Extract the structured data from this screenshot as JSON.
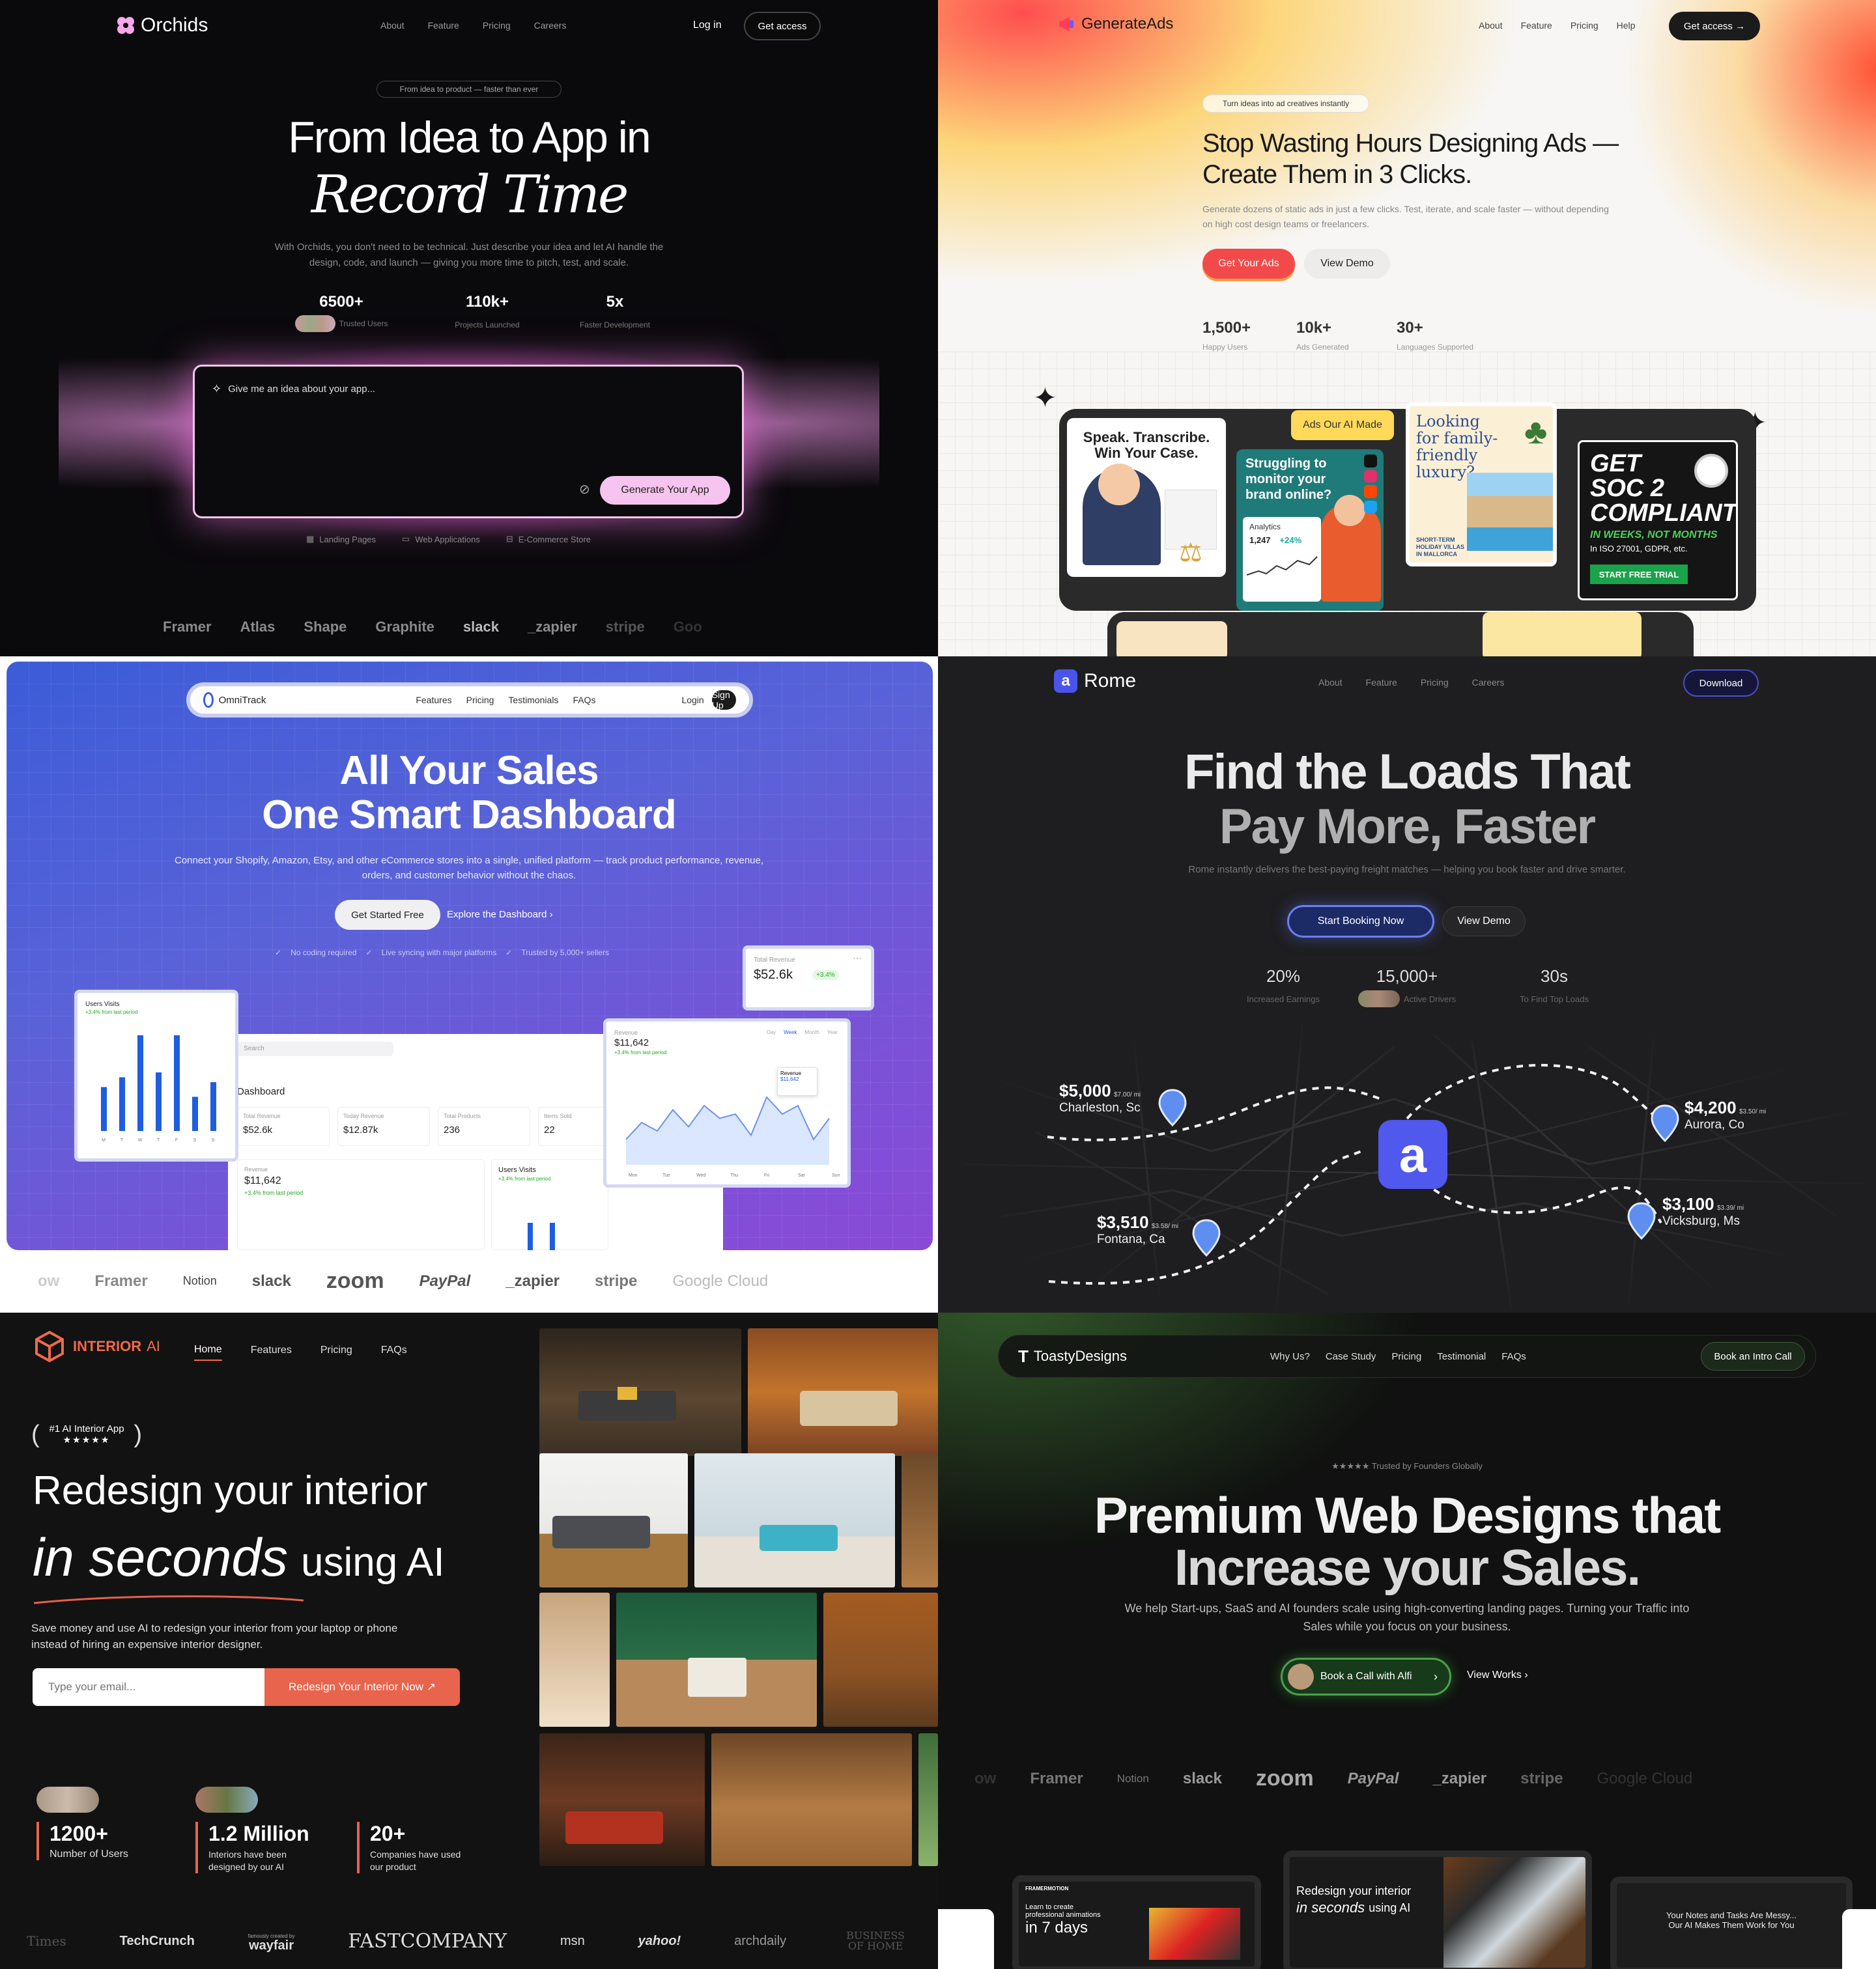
{
  "orchids": {
    "brand": "Orchids",
    "nav": [
      "About",
      "Feature",
      "Pricing",
      "Careers"
    ],
    "login": "Log in",
    "cta": "Get access",
    "badge": "From idea to product — faster than ever",
    "title1": "From Idea to App in",
    "title2": "Record Time",
    "sub": "With Orchids, you don't need to be technical. Just describe your idea and let AI handle the design, code, and launch — giving you more time to pitch, test, and scale.",
    "stats": [
      {
        "v": "6500+",
        "l": "Trusted Users"
      },
      {
        "v": "110k+",
        "l": "Projects Launched"
      },
      {
        "v": "5x",
        "l": "Faster Development"
      }
    ],
    "prompt_placeholder": "Give me an idea about your app...",
    "generate": "Generate Your App",
    "tags": [
      "Landing Pages",
      "Web Applications",
      "E-Commerce Store"
    ],
    "logos": [
      "Framer",
      "Atlas",
      "Shape",
      "Graphite",
      "slack",
      "_zapier",
      "stripe",
      "Goo"
    ]
  },
  "genads": {
    "brand": "GenerateAds",
    "nav": [
      "About",
      "Feature",
      "Pricing",
      "Help"
    ],
    "cta": "Get access →",
    "badge": "Turn ideas into ad creatives instantly",
    "title1": "Stop Wasting Hours Designing Ads —",
    "title2": "Create Them in 3 Clicks.",
    "sub": "Generate dozens of static ads in just a few clicks. Test, iterate, and scale faster — without depending on high cost design teams or freelancers.",
    "btn_primary": "Get Your Ads",
    "btn_secondary": "View Demo",
    "stats": [
      {
        "v": "1,500+",
        "l": "Happy Users"
      },
      {
        "v": "10k+",
        "l": "Ads Generated"
      },
      {
        "v": "30+",
        "l": "Languages Supported"
      }
    ],
    "made_label": "Ads Our AI Made",
    "card1": "Speak. Transcribe. Win Your Case.",
    "card2": "Struggling to monitor your brand online?",
    "card2_sub": "Analytics",
    "card2_m1": "1,247",
    "card2_m2": "+24%",
    "card3": "Looking for family-friendly luxury?",
    "card3_sub": "SHORT-TERM HOLIDAY VILLAS IN MALLORCA",
    "card4_t1": "GET",
    "card4_t2": "SOC 2",
    "card4_t3": "COMPLIANT",
    "card4_t4": "IN WEEKS, NOT MONTHS",
    "card4_t5": "In ISO 27001, GDPR, etc.",
    "card4_btn": "START FREE TRIAL"
  },
  "omni": {
    "brand": "OmniTrack",
    "nav": [
      "Features",
      "Pricing",
      "Testimonials",
      "FAQs"
    ],
    "login": "Login",
    "signup": "Sign Up",
    "title1": "All Your Sales",
    "title2": "One Smart Dashboard",
    "sub": "Connect your Shopify, Amazon, Etsy, and other eCommerce stores into a single, unified platform — track product performance, revenue, orders, and customer behavior without the chaos.",
    "btn_primary": "Get Started Free",
    "btn_secondary": "Explore the Dashboard ›",
    "checks": [
      "No coding required",
      "Live syncing with major platforms",
      "Trusted by 5,000+ sellers"
    ],
    "total_rev_label": "Total Revenue",
    "total_rev": "$52.6k",
    "total_rev_delta": "+3.4%",
    "users_visits": "Users Visits",
    "uv_delta": "+3.4% from last period",
    "rev_label": "Revenue",
    "rev_value": "$11,642",
    "rev_delta": "+3.4% from last period",
    "dash_title": "Dashboard",
    "search": "Search",
    "kpis": [
      {
        "l": "Total Revenue",
        "v": "$52.6k",
        "d": "+3.4%"
      },
      {
        "l": "Today Revenue",
        "v": "$12.87k",
        "d": "-3.5%"
      },
      {
        "l": "Total Products",
        "v": "236"
      },
      {
        "l": "Items Sold",
        "v": "22"
      }
    ],
    "days": [
      "Mon",
      "Tue",
      "Wed",
      "Thu",
      "Fri",
      "Sat",
      "Sun"
    ],
    "tabs": [
      "Day",
      "Week",
      "Month",
      "Year"
    ],
    "bar_days": [
      "M",
      "T",
      "W",
      "T",
      "F",
      "S",
      "S"
    ],
    "logos": [
      "ow",
      "Framer",
      "Notion",
      "slack",
      "zoom",
      "PayPal",
      "_zapier",
      "stripe",
      "Google Cloud"
    ]
  },
  "rome": {
    "brand": "Rome",
    "nav": [
      "About",
      "Feature",
      "Pricing",
      "Careers"
    ],
    "cta": "Download",
    "title1": "Find the Loads That",
    "title2": "Pay More, Faster",
    "sub": "Rome instantly delivers the best-paying freight matches — helping you book faster and drive smarter.",
    "btn_primary": "Start Booking Now",
    "btn_secondary": "View Demo",
    "stats": [
      {
        "v": "20%",
        "l": "Increased Earnings"
      },
      {
        "v": "15,000+",
        "l": "Active Drivers"
      },
      {
        "v": "30s",
        "l": "To Find Top Loads"
      }
    ],
    "loads": [
      {
        "p": "$5,000",
        "r": "$7.00/ mi",
        "c": "Charleston, Sc"
      },
      {
        "p": "$4,200",
        "r": "$3.50/ mi",
        "c": "Aurora, Co"
      },
      {
        "p": "$3,510",
        "r": "$3.58/ mi",
        "c": "Fontana, Ca"
      },
      {
        "p": "$3,100",
        "r": "$3.39/ mi",
        "c": "Vicksburg, Ms"
      }
    ]
  },
  "interior": {
    "brand": "INTERIOR",
    "brand2": "AI",
    "nav": [
      "Home",
      "Features",
      "Pricing",
      "FAQs"
    ],
    "award": "#1 AI Interior App",
    "stars": "★★★★★",
    "title1": "Redesign your interior",
    "title2a": "in seconds",
    "title2b": "using AI",
    "sub": "Save money and use AI to redesign your interior from your laptop or phone instead of hiring an expensive interior designer.",
    "email_placeholder": "Type your email...",
    "cta": "Redesign Your Interior Now ↗",
    "stats": [
      {
        "v": "1200+",
        "l": "Number of Users"
      },
      {
        "v": "1.2 Million",
        "l": "Interiors have been designed by our AI"
      },
      {
        "v": "20+",
        "l": "Companies have used our product"
      }
    ],
    "logos": [
      "Times",
      "TechCrunch",
      "wayfair",
      "FASTCOMPANY",
      "msn",
      "yahoo!",
      "archdaily",
      "BUSINESS OF HOME"
    ],
    "wayfair_pre": "famously created by"
  },
  "toasty": {
    "brand": "ToastyDesigns",
    "nav": [
      "Why Us?",
      "Case Study",
      "Pricing",
      "Testimonial",
      "FAQs"
    ],
    "cta": "Book an Intro Call",
    "trust": "★★★★★ Trusted by Founders Globally",
    "title1": "Premium Web Designs that",
    "title2": "Increase your Sales.",
    "sub": "We help Start-ups, SaaS and AI founders scale using high-converting landing pages. Turning your Traffic into Sales while you focus on your business.",
    "btn_primary": "Book a Call with Alfi",
    "btn_secondary": "View Works ›",
    "logos": [
      "ow",
      "Framer",
      "Notion",
      "slack",
      "zoom",
      "PayPal",
      "_zapier",
      "stripe",
      "Google Cloud"
    ],
    "shot1_t1": "Learn to create",
    "shot1_t2": "professional animations",
    "shot1_t3": "in 7 days",
    "shot1_brand": "FRAMERMOTION",
    "shot2_t1": "Redesign your interior",
    "shot2_t2": "in seconds",
    "shot2_t3": "using AI",
    "shot3_t1": "Your Notes and Tasks Are Messy...",
    "shot3_t2": "Our AI Makes Them Work for You"
  }
}
